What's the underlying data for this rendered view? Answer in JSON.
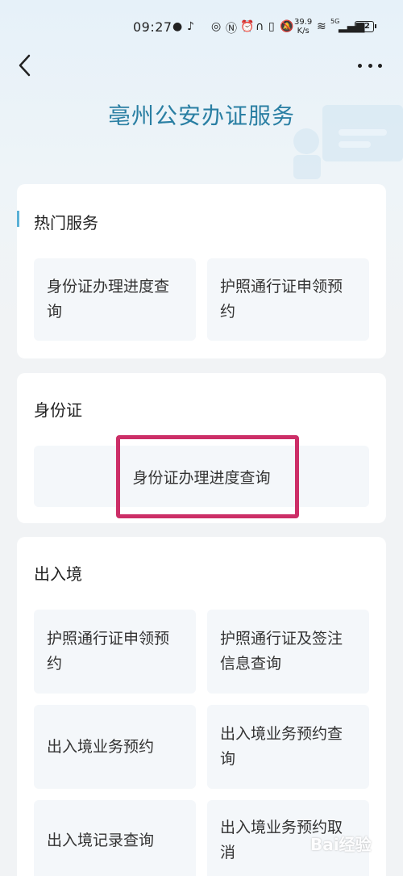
{
  "status_bar": {
    "time": "09:27",
    "net_speed_value": "39.9",
    "net_speed_unit": "K/s",
    "network_type": "5G",
    "battery": "82"
  },
  "header": {
    "title": "亳州公安办证服务"
  },
  "sections": {
    "hot": {
      "title": "热门服务",
      "items": [
        "身份证办理进度查询",
        "护照通行证申领预约"
      ]
    },
    "id_card": {
      "title": "身份证",
      "items": [
        "身份证办理进度查询"
      ]
    },
    "exit_entry": {
      "title": "出入境",
      "items": [
        "护照通行证申领预约",
        "护照通行证及签注信息查询",
        "出入境业务预约",
        "出入境业务预约查询",
        "出入境记录查询",
        "出入境业务预约取消"
      ]
    }
  },
  "watermark": "Bai经验",
  "colors": {
    "title": "#2a7fa3",
    "highlight": "#cc2e67",
    "tile_bg": "#f4f7fa"
  }
}
